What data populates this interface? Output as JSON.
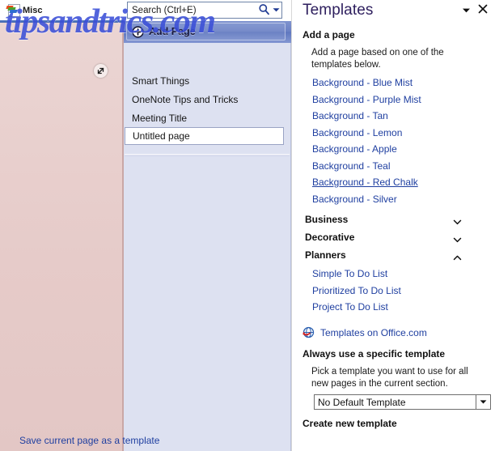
{
  "watermark": {
    "text": "tipsandtrics.com"
  },
  "section_tab": {
    "label": "Misc",
    "icon": "onenote-section-icon"
  },
  "canvas": {
    "expand_icon": "expand-diagonal-icon"
  },
  "search": {
    "placeholder": "Search (Ctrl+E)",
    "value": "Search (Ctrl+E)",
    "search_icon": "search-icon",
    "dropdown_icon": "chevron-down-icon"
  },
  "page_list": {
    "add_page_label": "Add Page",
    "add_page_icon": "plus-circle-icon",
    "items": [
      {
        "label": "Smart Things",
        "selected": false
      },
      {
        "label": "OneNote Tips and Tricks",
        "selected": false
      },
      {
        "label": "Meeting Title",
        "selected": false
      },
      {
        "label": "Untitled page",
        "selected": true
      }
    ]
  },
  "task_pane": {
    "title": "Templates",
    "menu_icon": "chevron-down-icon",
    "close_icon": "close-icon",
    "add_page_heading": "Add a page",
    "add_page_description": "Add a page based on one of the templates below.",
    "templates": [
      {
        "label": "Background - Blue Mist",
        "hovered": false
      },
      {
        "label": "Background - Purple Mist",
        "hovered": false
      },
      {
        "label": "Background - Tan",
        "hovered": false
      },
      {
        "label": "Background - Lemon",
        "hovered": false
      },
      {
        "label": "Background - Apple",
        "hovered": false
      },
      {
        "label": "Background - Teal",
        "hovered": false
      },
      {
        "label": "Background - Red Chalk",
        "hovered": true
      },
      {
        "label": "Background - Silver",
        "hovered": false
      }
    ],
    "groups": [
      {
        "label": "Business",
        "expanded": false,
        "chevron": "chevron-down-icon",
        "children": []
      },
      {
        "label": "Decorative",
        "expanded": false,
        "chevron": "chevron-down-icon",
        "children": []
      },
      {
        "label": "Planners",
        "expanded": true,
        "chevron": "chevron-up-icon",
        "children": [
          "Simple To Do List",
          "Prioritized To Do List",
          "Project To Do List"
        ]
      }
    ],
    "scrollbar": {
      "up_icon": "scroll-up-icon",
      "down_icon": "scroll-down-icon",
      "thumb_position": "near-bottom"
    },
    "office_link": {
      "label": "Templates on Office.com",
      "icon": "globe-web-icon"
    },
    "always_use_heading": "Always use a specific template",
    "always_use_description": "Pick a template you want to use for all new pages in the current section.",
    "default_template_value": "No Default Template",
    "default_template_arrow_icon": "chevron-down-icon",
    "create_new_heading": "Create new template",
    "save_current_link": "Save current page as a template"
  },
  "colors": {
    "accent_blue": "#1f3fa0",
    "title_purple": "#2e1f5e",
    "page_list_bg": "#dde1f1",
    "canvas_pink": "#e6cbc9",
    "add_page_band": "#6b81c5",
    "watermark_blue": "#3b4fd8"
  }
}
